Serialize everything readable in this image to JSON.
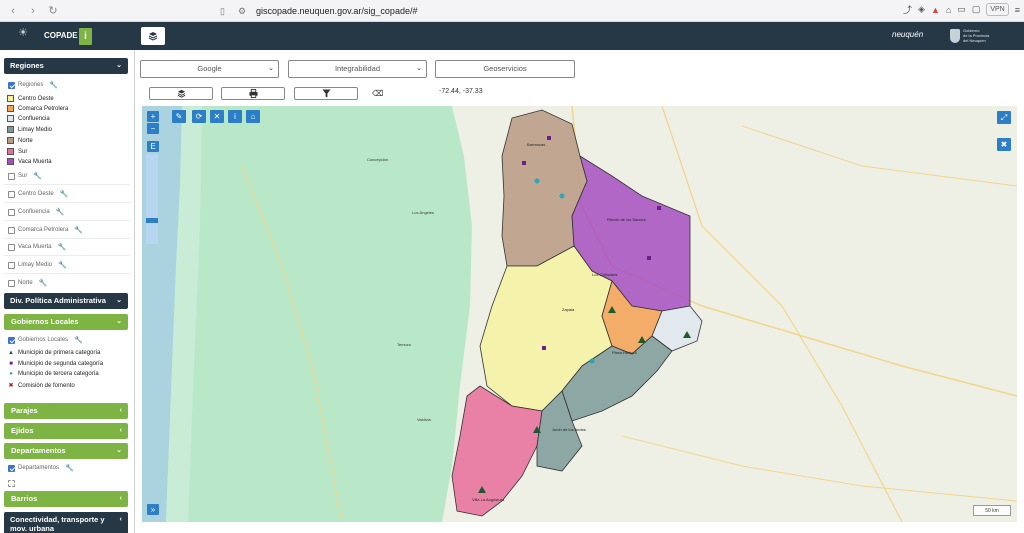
{
  "browser": {
    "url": "giscopade.neuquen.gov.ar/sig_copade/#",
    "vpn_label": "VPN",
    "badge_count": "1"
  },
  "header": {
    "logo_text": "COPADE",
    "title": "COPADE",
    "info_label": "i",
    "brand_neuquen": "neuquén",
    "brand_gob_line1": "Gobierno",
    "brand_gob_line2": "de la Provincia",
    "brand_gob_line3": "del Neuquén"
  },
  "sidebar": {
    "regiones_header": "Regiones",
    "regiones_layer": "Regiones",
    "regions": [
      {
        "label": "Centro Oeste",
        "color": "#f4f2a0"
      },
      {
        "label": "Comarca Petrolera",
        "color": "#f3a55a"
      },
      {
        "label": "Confluencia",
        "color": "#dfe8ee"
      },
      {
        "label": "Limay Medio",
        "color": "#7a9a98"
      },
      {
        "label": "Norte",
        "color": "#b89a82"
      },
      {
        "label": "Sur",
        "color": "#e86d9a"
      },
      {
        "label": "Vaca Muerta",
        "color": "#a64fbf"
      }
    ],
    "sub_layers": [
      "Sur",
      "Centro Oeste",
      "Confluencia",
      "Comarca Petrolera",
      "Vaca Muerta",
      "Limay Medio",
      "Norte"
    ],
    "div_politica_header": "Div. Política Administrativa",
    "gobiernos_header": "Gobiernos Locales",
    "gobiernos_layer": "Gobiernos Locales",
    "gob_legend": [
      {
        "label": "Municipio de primera categoría",
        "symbol": "▲",
        "color": "#1f5a2c"
      },
      {
        "label": "Municipio de segunda categoría",
        "symbol": "■",
        "color": "#6a1f8a"
      },
      {
        "label": "Municipio de tercera categoría",
        "symbol": "●",
        "color": "#2aa6b8"
      },
      {
        "label": "Comisión de fomento",
        "symbol": "✖",
        "color": "#b3161a"
      }
    ],
    "parajes_header": "Parajes",
    "ejidos_header": "Ejidos",
    "departamentos_header": "Departamentos",
    "departamentos_layer": "Departamentos",
    "barrios_header": "Barrios",
    "conectividad_header_line1": "Conectividad, transporte y",
    "conectividad_header_line2": "mov. urbana"
  },
  "toolbar": {
    "basemap_value": "Google",
    "integrabilidad_value": "Integrabilidad",
    "geoservicios_label": "Geoservicios",
    "coords": "-72.44, -37.33"
  },
  "map": {
    "zoom_in": "+",
    "zoom_out": "−",
    "e_label": "E",
    "scale_label": "50 km",
    "expand_label": "»"
  }
}
